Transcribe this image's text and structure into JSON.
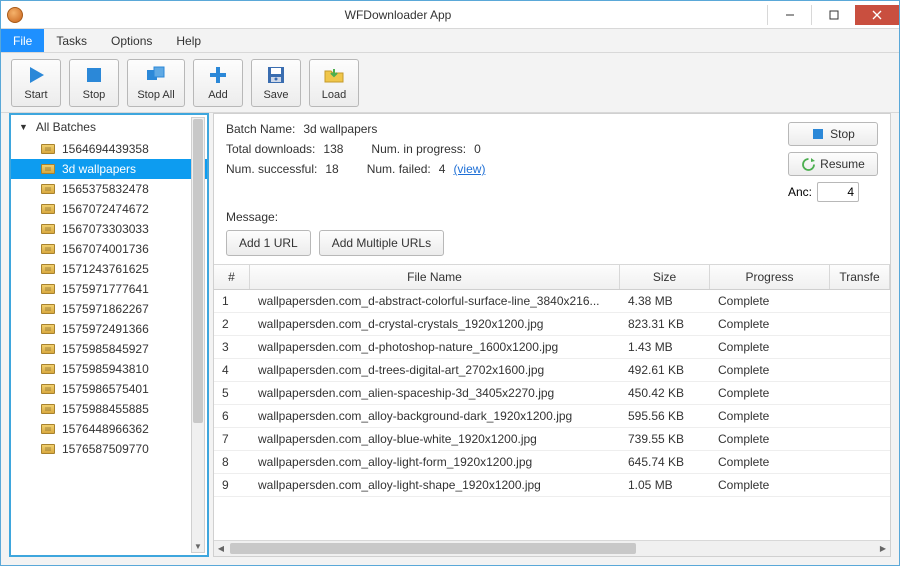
{
  "window": {
    "title": "WFDownloader App"
  },
  "menubar": {
    "items": [
      "File",
      "Tasks",
      "Options",
      "Help"
    ],
    "active_index": 0
  },
  "toolbar": {
    "start": "Start",
    "stop": "Stop",
    "stopall": "Stop All",
    "add": "Add",
    "save": "Save",
    "load": "Load"
  },
  "sidebar": {
    "root_label": "All Batches",
    "items": [
      "1564694439358",
      "3d wallpapers",
      "1565375832478",
      "1567072474672",
      "1567073303033",
      "1567074001736",
      "1571243761625",
      "1575971777641",
      "1575971862267",
      "1575972491366",
      "1575985845927",
      "1575985943810",
      "1575986575401",
      "1575988455885",
      "1576448966362",
      "1576587509770"
    ],
    "selected_index": 1
  },
  "details": {
    "batch_name_label": "Batch Name:",
    "batch_name": "3d wallpapers",
    "total_label": "Total downloads:",
    "total": "138",
    "progress_label": "Num. in progress:",
    "progress": "0",
    "success_label": "Num. successful:",
    "success": "18",
    "failed_label": "Num. failed:",
    "failed": "4",
    "view_label": "(view)",
    "message_label": "Message:",
    "stop_btn": "Stop",
    "resume_btn": "Resume",
    "anc_label": "Anc:",
    "anc_value": "4",
    "add1": "Add 1 URL",
    "addmany": "Add Multiple URLs"
  },
  "table": {
    "headers": {
      "num": "#",
      "filename": "File Name",
      "size": "Size",
      "progress": "Progress",
      "transfer": "Transfe"
    },
    "rows": [
      {
        "n": "1",
        "fn": "wallpapersden.com_d-abstract-colorful-surface-line_3840x216...",
        "sz": "4.38 MB",
        "pg": "Complete"
      },
      {
        "n": "2",
        "fn": "wallpapersden.com_d-crystal-crystals_1920x1200.jpg",
        "sz": "823.31 KB",
        "pg": "Complete"
      },
      {
        "n": "3",
        "fn": "wallpapersden.com_d-photoshop-nature_1600x1200.jpg",
        "sz": "1.43 MB",
        "pg": "Complete"
      },
      {
        "n": "4",
        "fn": "wallpapersden.com_d-trees-digital-art_2702x1600.jpg",
        "sz": "492.61 KB",
        "pg": "Complete"
      },
      {
        "n": "5",
        "fn": "wallpapersden.com_alien-spaceship-3d_3405x2270.jpg",
        "sz": "450.42 KB",
        "pg": "Complete"
      },
      {
        "n": "6",
        "fn": "wallpapersden.com_alloy-background-dark_1920x1200.jpg",
        "sz": "595.56 KB",
        "pg": "Complete"
      },
      {
        "n": "7",
        "fn": "wallpapersden.com_alloy-blue-white_1920x1200.jpg",
        "sz": "739.55 KB",
        "pg": "Complete"
      },
      {
        "n": "8",
        "fn": "wallpapersden.com_alloy-light-form_1920x1200.jpg",
        "sz": "645.74 KB",
        "pg": "Complete"
      },
      {
        "n": "9",
        "fn": "wallpapersden.com_alloy-light-shape_1920x1200.jpg",
        "sz": "1.05 MB",
        "pg": "Complete"
      }
    ]
  }
}
